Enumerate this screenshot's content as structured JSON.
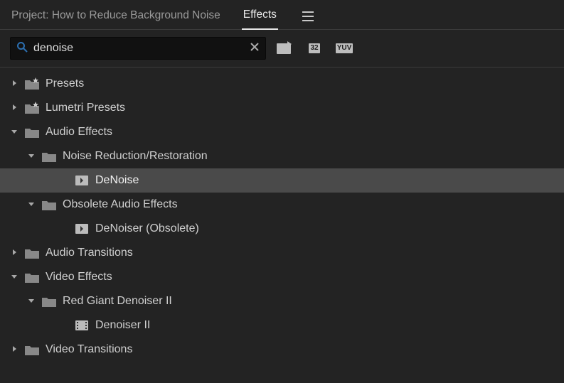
{
  "tabs": {
    "project_label": "Project: How to Reduce Background Noise",
    "effects_label": "Effects"
  },
  "search": {
    "value": "denoise",
    "placeholder": ""
  },
  "toolbar_buttons": {
    "new_bin": "new-bin",
    "badge32": "32",
    "badgeYuv": "YUV"
  },
  "tree": [
    {
      "label": "Presets",
      "indent": 0,
      "expanded": false,
      "icon": "folder-star",
      "leaf": false,
      "selected": false
    },
    {
      "label": "Lumetri Presets",
      "indent": 0,
      "expanded": false,
      "icon": "folder-star",
      "leaf": false,
      "selected": false
    },
    {
      "label": "Audio Effects",
      "indent": 0,
      "expanded": true,
      "icon": "folder",
      "leaf": false,
      "selected": false
    },
    {
      "label": "Noise Reduction/Restoration",
      "indent": 1,
      "expanded": true,
      "icon": "folder",
      "leaf": false,
      "selected": false
    },
    {
      "label": "DeNoise",
      "indent": 2,
      "expanded": null,
      "icon": "audio-fx",
      "leaf": true,
      "selected": true
    },
    {
      "label": "Obsolete Audio Effects",
      "indent": 1,
      "expanded": true,
      "icon": "folder",
      "leaf": false,
      "selected": false
    },
    {
      "label": "DeNoiser (Obsolete)",
      "indent": 2,
      "expanded": null,
      "icon": "audio-fx",
      "leaf": true,
      "selected": false
    },
    {
      "label": "Audio Transitions",
      "indent": 0,
      "expanded": false,
      "icon": "folder",
      "leaf": false,
      "selected": false
    },
    {
      "label": "Video Effects",
      "indent": 0,
      "expanded": true,
      "icon": "folder",
      "leaf": false,
      "selected": false
    },
    {
      "label": "Red Giant Denoiser II",
      "indent": 1,
      "expanded": true,
      "icon": "folder",
      "leaf": false,
      "selected": false
    },
    {
      "label": "Denoiser II",
      "indent": 2,
      "expanded": null,
      "icon": "video-fx",
      "leaf": true,
      "selected": false
    },
    {
      "label": "Video Transitions",
      "indent": 0,
      "expanded": false,
      "icon": "folder",
      "leaf": false,
      "selected": false
    }
  ]
}
